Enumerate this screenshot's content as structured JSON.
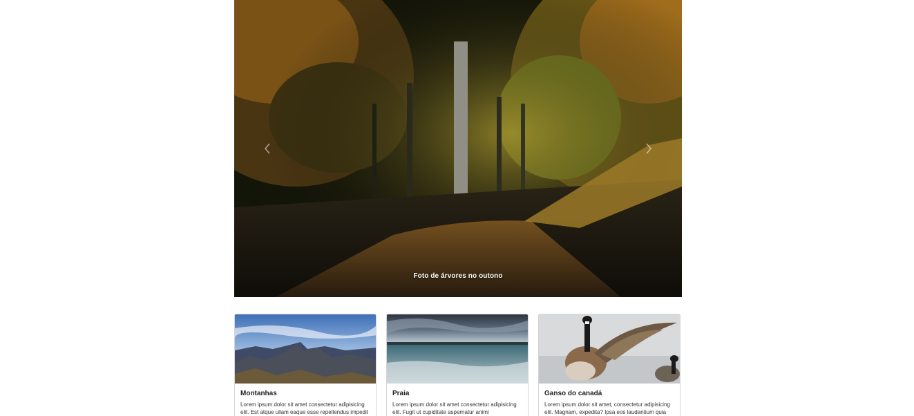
{
  "carousel": {
    "caption": "Foto de árvores no outono",
    "prev_label": "Previous",
    "next_label": "Next",
    "prev_icon": "chevron-left-icon",
    "next_icon": "chevron-right-icon"
  },
  "cards": [
    {
      "title": "Montanhas",
      "text": "Lorem ipsum dolor sit amet consectetur adipisicing elit. Est atque ullam eaque esse repellendus impedit"
    },
    {
      "title": "Praia",
      "text": "Lorem ipsum dolor sit amet consectetur adipisicing elit. Fugit ut cupiditate aspernatur animi"
    },
    {
      "title": "Ganso do canadá",
      "text": "Lorem ipsum dolor sit amet, consectetur adipisicing elit. Magnam, expedita? Ipsa eos laudantium quia"
    }
  ]
}
